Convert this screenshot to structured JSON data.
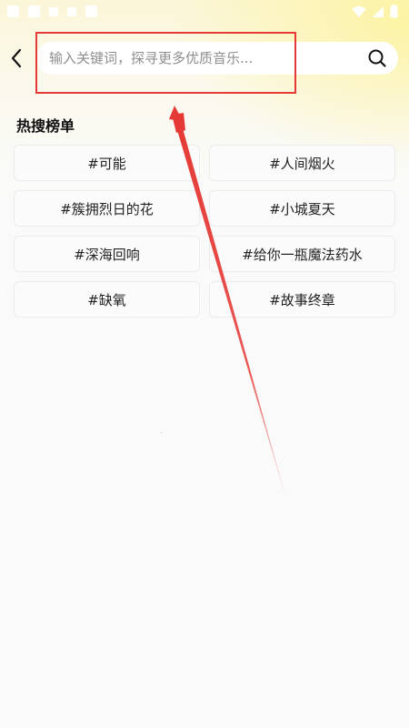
{
  "header": {
    "search_placeholder": "输入关键词，探寻更多优质音乐..."
  },
  "hot_search": {
    "title": "热搜榜单",
    "items": [
      "#可能",
      "#人间烟火",
      "#簇拥烈日的花",
      "#小城夏天",
      "#深海回响",
      "#给你一瓶魔法药水",
      "#缺氧",
      "#故事终章"
    ]
  },
  "annotation": {
    "color": "#e53935"
  }
}
